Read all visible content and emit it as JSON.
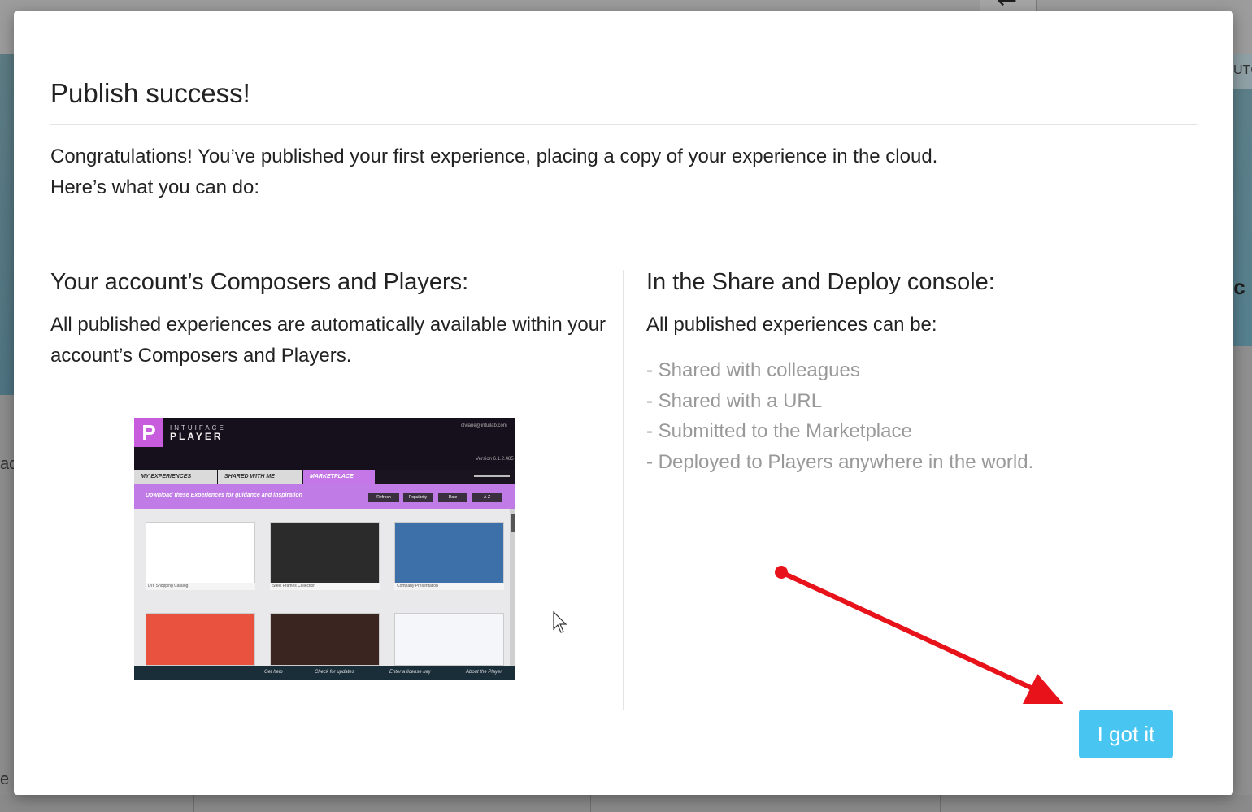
{
  "modal": {
    "title": "Publish success!",
    "intro_line1": "Congratulations! You’ve published your first experience, placing a copy of your experience in the cloud.",
    "intro_line2": "Here’s what you can do:",
    "left_heading": "Your account’s Composers and Players:",
    "left_text": "All published experiences are automatically available within your account’s Composers and Players.",
    "right_heading": "In the Share and Deploy console:",
    "right_text": "All published experiences can be:",
    "share_items": [
      "- Shared with colleagues",
      "- Shared with a URL",
      "- Submitted to the Marketplace",
      "- Deployed to Players anywhere in the world."
    ],
    "button_label": "I got it"
  },
  "player_screenshot": {
    "logo_letter": "P",
    "brand_small": "INTUIFACE",
    "brand": "PLAYER",
    "email": "clvlane@intuilab.com",
    "version": "Version 6.1.2.485",
    "tabs": [
      "MY EXPERIENCES",
      "SHARED WITH ME",
      "MARKETPLACE"
    ],
    "filter_text": "Download these Experiences for guidance and inspiration",
    "filter_buttons": [
      "Refresh",
      "Popularity",
      "Date",
      "A-Z"
    ],
    "cards": [
      {
        "caption": "DIY Shopping Catalog",
        "color": "#ffffff"
      },
      {
        "caption": "Steel Frames Collection",
        "color": "#2b2b2b"
      },
      {
        "caption": "Company Presentation",
        "color": "#3d6fa8"
      },
      {
        "caption": "",
        "color": "#e8523f"
      },
      {
        "caption": "",
        "color": "#3a2520"
      },
      {
        "caption": "",
        "color": "#f4f6fa"
      }
    ],
    "bottom_items": [
      "Get help",
      "Check for updates",
      "Enter a license key",
      "About the Player"
    ]
  },
  "background": {
    "left_fragment_1": "ac",
    "left_fragment_2": "e v",
    "right_fragment_1": "UTC",
    "right_fragment_2": ".c"
  },
  "colors": {
    "button_bg": "#49c5f1",
    "annotation_arrow": "#e8121b",
    "muted_list_text": "#999999"
  }
}
